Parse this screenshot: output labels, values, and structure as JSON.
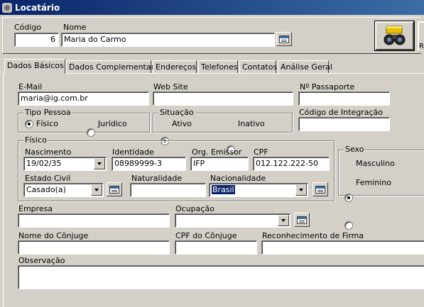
{
  "window": {
    "title": "Locatário"
  },
  "header": {
    "codigo_label": "Código",
    "codigo_value": "6",
    "nome_label": "Nome",
    "nome_value": "Maria do Carmo",
    "edge_label": "R"
  },
  "tabs": [
    {
      "label": "Dados Básicos",
      "active": true
    },
    {
      "label": "Dados Complementares",
      "active": false
    },
    {
      "label": "Endereços",
      "active": false
    },
    {
      "label": "Telefones",
      "active": false
    },
    {
      "label": "Contatos",
      "active": false
    },
    {
      "label": "Análise Geral",
      "active": false
    }
  ],
  "form": {
    "email_label": "E-Mail",
    "email_value": "maria@ig.com.br",
    "website_label": "Web Site",
    "website_value": "",
    "passaporte_label": "Nº Passaporte",
    "passaporte_value": "",
    "tipo_pessoa": {
      "label": "Tipo Pessoa",
      "options": [
        "Físico",
        "Jurídico"
      ],
      "selected": "Físico"
    },
    "situacao": {
      "label": "Situação",
      "options": [
        "Ativo",
        "Inativo"
      ],
      "selected": "Ativo"
    },
    "codigo_integracao_label": "Código de Integração",
    "codigo_integracao_value": "",
    "fisico": {
      "label": "Físico",
      "nascimento_label": "Nascimento",
      "nascimento_value": "19/02/35",
      "identidade_label": "Identidade",
      "identidade_value": "08989999-3",
      "orgao_label": "Org. Emissor",
      "orgao_value": "IFP",
      "cpf_label": "CPF",
      "cpf_value": "012.122.222-50",
      "estado_civil_label": "Estado Civil",
      "estado_civil_value": "Casado(a)",
      "naturalidade_label": "Naturalidade",
      "naturalidade_value": "",
      "nacionalidade_label": "Nacionalidade",
      "nacionalidade_value": "Brasil"
    },
    "sexo": {
      "label": "Sexo",
      "options": [
        "Masculino",
        "Feminino"
      ],
      "selected": "Masculino"
    },
    "empresa_label": "Empresa",
    "empresa_value": "",
    "ocupacao_label": "Ocupação",
    "ocupacao_value": "",
    "conjuge_label": "Nome do Cônjuge",
    "conjuge_value": "",
    "cpf_conjuge_label": "CPF do Cônjuge",
    "cpf_conjuge_value": "",
    "firma_label": "Reconhecimento de Firma",
    "firma_value": "",
    "observacao_label": "Observação",
    "observacao_value": ""
  },
  "colors": {
    "titlebar": "#0a246a",
    "face": "#d4d0c8",
    "selection": "#0a246a"
  }
}
